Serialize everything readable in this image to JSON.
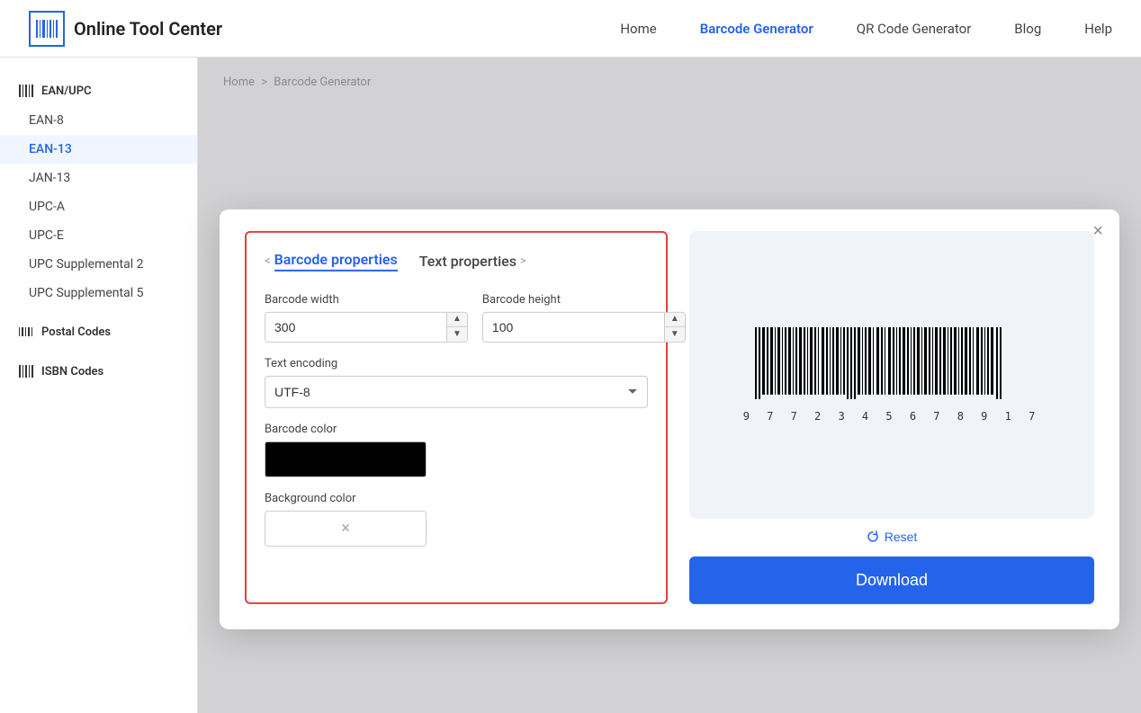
{
  "header": {
    "logo_text": "Online Tool Center",
    "nav_items": [
      {
        "label": "Home",
        "active": false
      },
      {
        "label": "Barcode Generator",
        "active": true
      },
      {
        "label": "QR Code Generator",
        "active": false
      },
      {
        "label": "Blog",
        "active": false
      },
      {
        "label": "Help",
        "active": false
      }
    ]
  },
  "sidebar": {
    "sections": [
      {
        "title": "EAN/UPC",
        "items": [
          {
            "label": "EAN-8",
            "active": false
          },
          {
            "label": "EAN-13",
            "active": true
          },
          {
            "label": "JAN-13",
            "active": false
          },
          {
            "label": "UPC-A",
            "active": false
          },
          {
            "label": "UPC-E",
            "active": false
          },
          {
            "label": "UPC Supplemental 2",
            "active": false
          },
          {
            "label": "UPC Supplemental 5",
            "active": false
          }
        ]
      },
      {
        "title": "Postal Codes",
        "items": []
      },
      {
        "title": "ISBN Codes",
        "items": []
      }
    ]
  },
  "breadcrumb": {
    "home": "Home",
    "separator": ">",
    "current": "Barcode Generator"
  },
  "modal": {
    "close_label": "×",
    "panel_tabs": [
      {
        "label": "Barcode properties",
        "active": true,
        "prefix": "<",
        "suffix": ""
      },
      {
        "label": "Text properties",
        "active": false,
        "prefix": "",
        "suffix": ">"
      }
    ],
    "barcode_width_label": "Barcode width",
    "barcode_width_value": "300",
    "barcode_height_label": "Barcode height",
    "barcode_height_value": "100",
    "text_encoding_label": "Text encoding",
    "text_encoding_value": "UTF-8",
    "barcode_color_label": "Barcode color",
    "background_color_label": "Background color",
    "background_clear": "×",
    "reset_label": "Reset",
    "download_label": "Download",
    "barcode_numbers": "9  7  7  2  3  4  5  6  7  8  9  1  7"
  }
}
